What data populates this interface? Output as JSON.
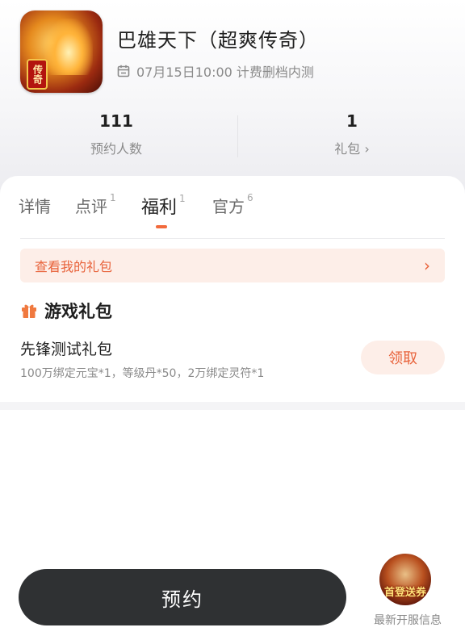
{
  "app": {
    "title": "巴雄天下（超爽传奇）",
    "icon_badge_text": "传奇",
    "icon_name": "game-icon",
    "date_icon_name": "calendar-icon",
    "date_text": "07月15日10:00 计费删档内测"
  },
  "stats": [
    {
      "value": "111",
      "label": "预约人数"
    },
    {
      "value": "1",
      "label": "礼包 ›"
    }
  ],
  "tabs": [
    {
      "label": "详情",
      "sup": ""
    },
    {
      "label": "点评",
      "sup": "1"
    },
    {
      "label": "福利",
      "sup": "1"
    },
    {
      "label": "官方",
      "sup": "6"
    }
  ],
  "active_tab_index": 2,
  "welfare": {
    "my_gifts_label": "查看我的礼包",
    "my_gifts_chevron": "›",
    "section_icon_name": "gift-icon",
    "section_title": "游戏礼包",
    "gift": {
      "name": "先锋测试礼包",
      "description": "100万绑定元宝*1，等级丹*50，2万绑定灵符*1",
      "claim_label": "领取"
    }
  },
  "bottom": {
    "reserve_label": "预约",
    "server_thumb_text": "首登送券",
    "server_info_label": "最新开服信息"
  },
  "colors": {
    "accent": "#e8623a",
    "accent_bg": "#fdeee8",
    "dark_button": "#2f3133",
    "muted_text": "#8a8a8a"
  }
}
